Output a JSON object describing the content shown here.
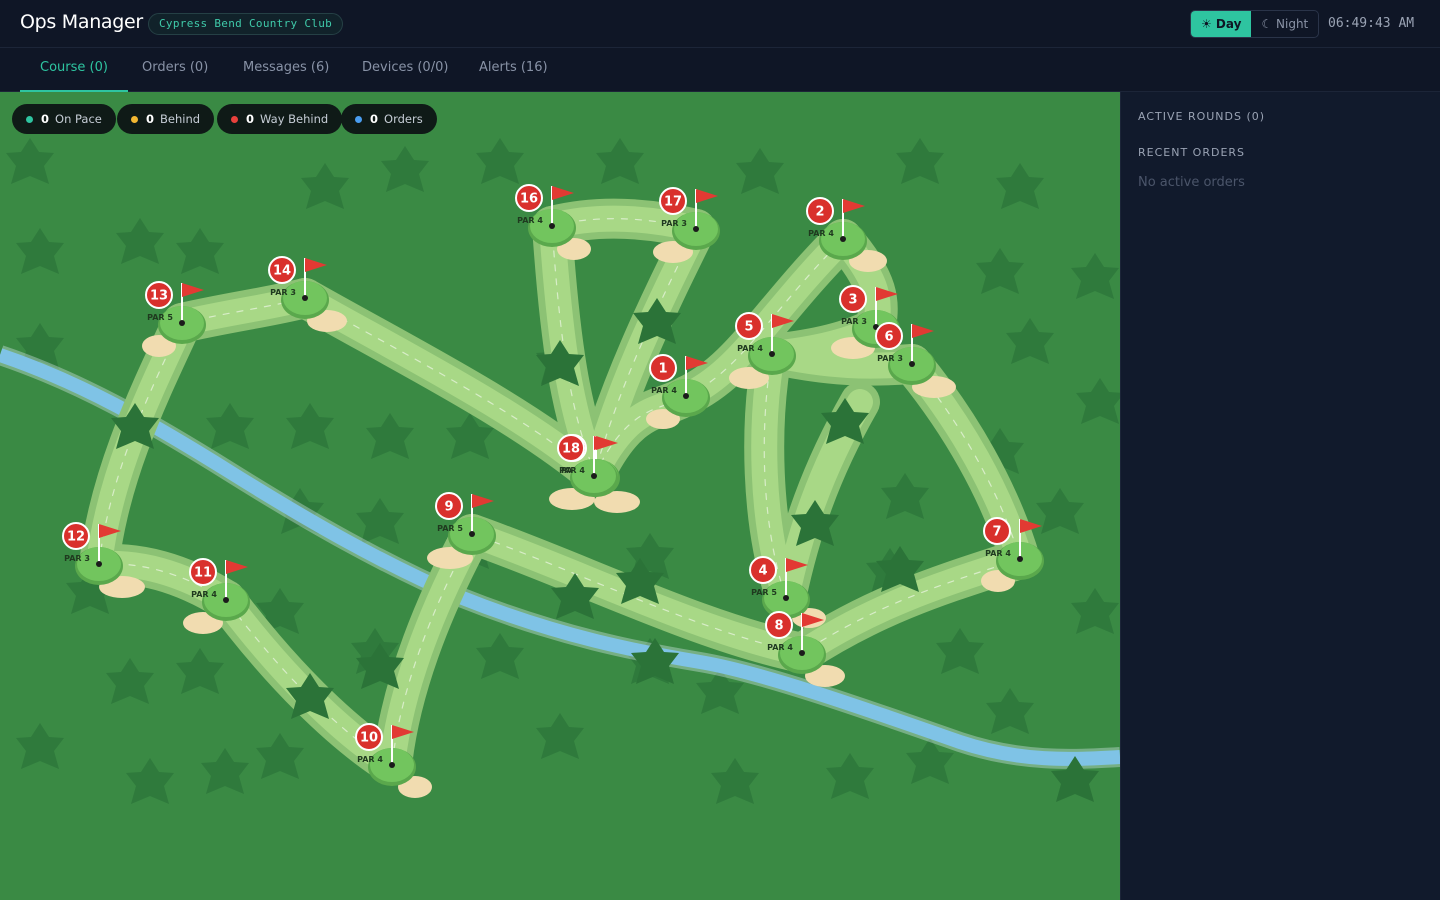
{
  "header": {
    "app_title": "Ops Manager",
    "club_name": "Cypress Bend Country Club",
    "mode_day": "☀ Day",
    "mode_night": "☾ Night",
    "active_mode": "Day",
    "clock": "06:49:43 AM"
  },
  "tabs": [
    {
      "label": "Course (0)",
      "active": true
    },
    {
      "label": "Orders (0)",
      "active": false
    },
    {
      "label": "Messages (6)",
      "active": false
    },
    {
      "label": "Devices (0/0)",
      "active": false
    },
    {
      "label": "Alerts (16)",
      "active": false
    }
  ],
  "legend": [
    {
      "count": "0",
      "label": "On Pace",
      "color": "#2ec4a0"
    },
    {
      "count": "0",
      "label": "Behind",
      "color": "#f2b732"
    },
    {
      "count": "0",
      "label": "Way Behind",
      "color": "#e8413c"
    },
    {
      "count": "0",
      "label": "Orders",
      "color": "#4a9df0"
    }
  ],
  "sidebar": {
    "active_rounds": "ACTIVE ROUNDS (0)",
    "recent_orders": "RECENT ORDERS",
    "empty_text": "No active orders"
  },
  "holes": [
    {
      "number": "1",
      "par": "PAR 4"
    },
    {
      "number": "2",
      "par": "PAR 4"
    },
    {
      "number": "3",
      "par": "PAR 3"
    },
    {
      "number": "4",
      "par": "PAR 5"
    },
    {
      "number": "5",
      "par": "PAR 4"
    },
    {
      "number": "6",
      "par": "PAR 3"
    },
    {
      "number": "7",
      "par": "PAR 4"
    },
    {
      "number": "8",
      "par": "PAR 4"
    },
    {
      "number": "9",
      "par": "PAR 5"
    },
    {
      "number": "10",
      "par": "PAR 4"
    },
    {
      "number": "11",
      "par": "PAR 4"
    },
    {
      "number": "12",
      "par": "PAR 3"
    },
    {
      "number": "13",
      "par": "PAR 5"
    },
    {
      "number": "14",
      "par": "PAR 3"
    },
    {
      "number": "15",
      "par": "PAR 5"
    },
    {
      "number": "16",
      "par": "PAR 4"
    },
    {
      "number": "17",
      "par": "PAR 3"
    },
    {
      "number": "18",
      "par": "PAR 4"
    }
  ],
  "colors": {
    "accent": "#2ec4a0",
    "map_grass": "#3a8a44",
    "fairway": "#a8d886",
    "green": "#6cc25a",
    "water": "#7fc3e6",
    "sand": "#f1dcb0",
    "flag": "#e23a33",
    "hole_badge": "#d9302c"
  }
}
